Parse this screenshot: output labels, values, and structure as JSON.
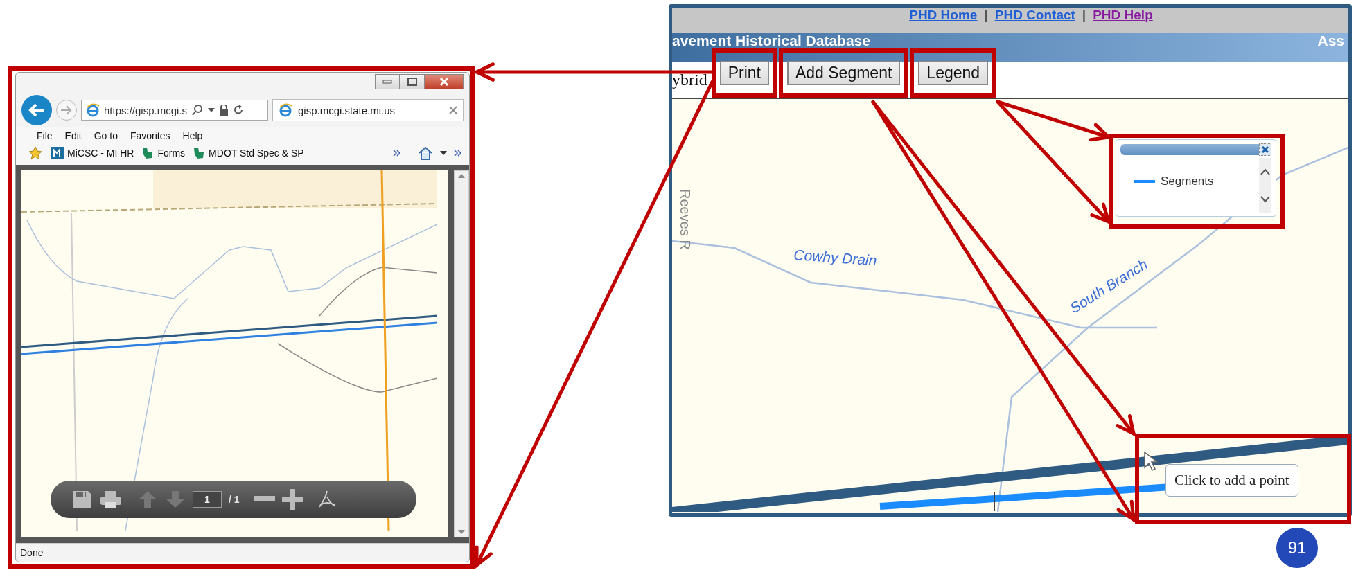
{
  "browser": {
    "address": "https://gisp.mcgi.s",
    "tab_title": "gisp.mcgi.state.mi.us",
    "menu": [
      "File",
      "Edit",
      "Go to",
      "Favorites",
      "Help"
    ],
    "favorites": [
      "MiCSC - MI HR",
      "Forms",
      "MDOT Std Spec & SP"
    ],
    "pdf_toolbar": {
      "page": "1",
      "page_total": "/ 1"
    },
    "status": "Done"
  },
  "app": {
    "nav_links": [
      {
        "label": "PHD Home",
        "visited": false
      },
      {
        "label": "PHD Contact",
        "visited": false
      },
      {
        "label": "PHD Help",
        "visited": true
      }
    ],
    "link_separators": [
      "|",
      "|"
    ],
    "title": "avement Historical Database",
    "title_right": "Ass",
    "toolbar_label": "ybrid",
    "buttons": [
      "Print",
      "Add Segment",
      "Legend"
    ],
    "legend": {
      "items": [
        "Segments"
      ]
    },
    "map_labels": [
      "Reeves R",
      "Cowhy Drain",
      "South Branch"
    ],
    "tooltip": "Click to add a point"
  },
  "slide_number": "91"
}
